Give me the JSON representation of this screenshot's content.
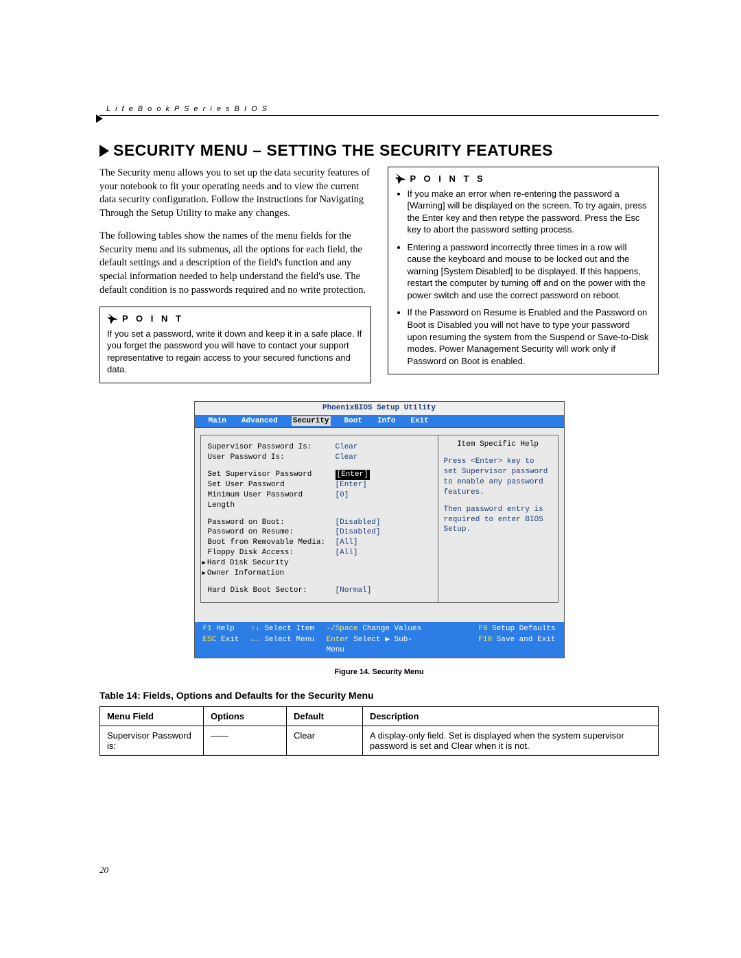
{
  "header": "L i f e B o o k   P   S e r i e s   B I O S",
  "title": "SECURITY MENU – SETTING THE SECURITY FEATURES",
  "intro": {
    "p1": "The Security menu allows you to set up the data security features of your notebook to fit your operating needs and to view the current data security configuration. Follow the instructions for Navigating Through the Setup Utility to make any changes.",
    "p2": "The following tables show the names of the menu fields for the Security menu and its submenus, all the options for each field, the default settings and a description of the field's function and any special information needed to help understand the field's use. The default condition is no passwords required and no write protection."
  },
  "point": {
    "label": "P O I N T",
    "text": "If you set a password, write it down and keep it in a safe place. If you forget the password you will have to contact your support representative to regain access to your secured functions and data."
  },
  "points": {
    "label": "P O I N T S",
    "items": [
      "If you make an error when re-entering the password a [Warning] will be displayed on the screen. To try again, press the Enter key and then retype the password. Press the Esc key to abort the password setting process.",
      "Entering a password incorrectly three times in a row will cause the keyboard and mouse to be locked out and the warning [System Disabled] to be displayed. If this happens, restart the computer by turning off and on the power with the power switch and use the correct password on reboot.",
      "If the Password on Resume is Enabled and the Password on Boot is Disabled you will not have to type your password upon resuming the system from the Suspend or Save-to-Disk modes. Power Management Security will work only if Password on Boot is enabled."
    ]
  },
  "bios": {
    "title": "PhoenixBIOS Setup Utility",
    "tabs": [
      "Main",
      "Advanced",
      "Security",
      "Boot",
      "Info",
      "Exit"
    ],
    "active_tab": "Security",
    "help_title": "Item Specific Help",
    "help_text_1": "Press <Enter> key to set Supervisor password to enable any password features.",
    "help_text_2": "Then password entry is required to enter BIOS Setup.",
    "rows": [
      {
        "k": "Supervisor Password Is:",
        "v": "Clear",
        "selected": false
      },
      {
        "k": "User Password Is:",
        "v": "Clear",
        "selected": false
      }
    ],
    "rows2": [
      {
        "k": "Set Supervisor Password",
        "v": "[Enter]",
        "selected": true
      },
      {
        "k": "Set User Password",
        "v": "[Enter]",
        "selected": false
      },
      {
        "k": "Minimum User Password Length",
        "v": "[0]",
        "selected": false
      }
    ],
    "rows3": [
      {
        "k": "Password on Boot:",
        "v": "[Disabled]",
        "selected": false
      },
      {
        "k": "Password on Resume:",
        "v": "[Disabled]",
        "selected": false
      },
      {
        "k": "Boot from Removable Media:",
        "v": "[All]",
        "selected": false
      },
      {
        "k": "Floppy Disk Access:",
        "v": "[All]",
        "selected": false
      }
    ],
    "subs": [
      "Hard Disk Security",
      "Owner Information"
    ],
    "rows4": [
      {
        "k": "Hard Disk Boot Sector:",
        "v": "[Normal]",
        "selected": false
      }
    ],
    "footer": {
      "r1": {
        "a_key": "F1",
        "a_lbl": "Help",
        "b_key": "↑↓",
        "b_lbl": "Select Item",
        "c_key": "-/Space",
        "c_lbl": "Change Values",
        "d_key": "F9",
        "d_lbl": "Setup Defaults"
      },
      "r2": {
        "a_key": "ESC",
        "a_lbl": "Exit",
        "b_key": "←→",
        "b_lbl": "Select Menu",
        "c_key": "Enter",
        "c_lbl": "Select ▶ Sub-Menu",
        "d_key": "F10",
        "d_lbl": "Save and Exit"
      }
    }
  },
  "figure_caption": "Figure 14.  Security Menu",
  "table_title": "Table 14: Fields, Options and Defaults for the Security Menu",
  "table": {
    "headers": [
      "Menu Field",
      "Options",
      "Default",
      "Description"
    ],
    "rows": [
      {
        "f": "Supervisor Password is:",
        "o": "——",
        "d": "Clear",
        "desc": "A display-only field. Set is displayed when the system supervisor password is set and Clear when it is not."
      }
    ]
  },
  "page_number": "20"
}
